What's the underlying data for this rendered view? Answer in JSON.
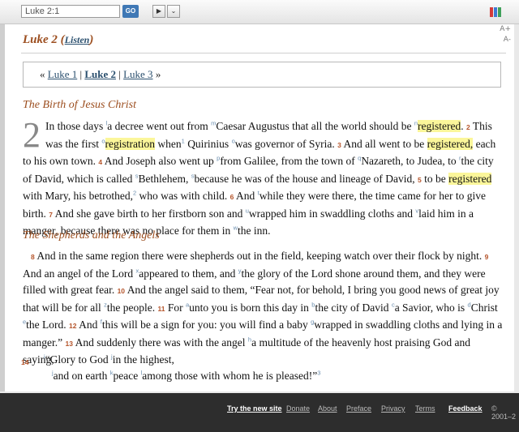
{
  "toolbar": {
    "search_value": "Luke 2:1",
    "go_label": "GO",
    "play_icon": "play-icon",
    "menu_icon": "chevron-down-icon",
    "font_increase": "A+",
    "font_decrease": "A-"
  },
  "passage": {
    "title": "Luke 2",
    "listen_label": "Listen",
    "nav": {
      "prev_open": "«",
      "prev": "Luke 1",
      "sep1": "|",
      "current": "Luke 2",
      "sep2": "|",
      "next": "Luke 3",
      "next_close": "»"
    },
    "sections": [
      {
        "heading": "The Birth of Jesus Christ"
      },
      {
        "heading": "The Shepherds and the Angels"
      }
    ],
    "chapter_number": "2"
  },
  "text": {
    "p1": [
      "In those days ",
      "a decree went out from ",
      "Caesar Augustus that all the world should be ",
      "registered",
      ".",
      "This was the first ",
      "registration",
      " when",
      " Quirinius ",
      "was governor of Syria.",
      "And all went to be ",
      "registered,",
      " each to his own town.",
      "And Joseph also went up ",
      "from Galilee, from the town of ",
      "Nazareth, to Judea, to ",
      "the city of David, which is called ",
      "Bethlehem, ",
      "because he was of the house and lineage of David,",
      "to be ",
      "registered",
      " with Mary, his betrothed,",
      " who was with child.",
      "And ",
      "while they were there, the time came for her to give birth.",
      "And she gave birth to her firstborn son and ",
      "wrapped him in swaddling cloths and ",
      "laid him in a manger, because there was no place for them in ",
      "the inn."
    ],
    "p2": [
      "And in the same region there were shepherds out in the field, keeping watch over their flock by night.",
      "And an angel of the Lord ",
      "appeared to them, and ",
      "the glory of the Lord shone around them, and they were filled with great fear.",
      "And the angel said to them, “Fear not, for behold, I bring you good news of great joy that will be for all ",
      "the people.",
      "For ",
      "unto you is born this day in ",
      "the city of David ",
      "a Savior, who is ",
      "Christ ",
      "the Lord.",
      "And ",
      "this will be a sign for you: you will find a baby ",
      "wrapped in swaddling cloths and lying in a manger.”",
      "And suddenly there was with the angel ",
      "a multitude of the heavenly host praising God and saying,"
    ],
    "poem": [
      "“Glory to God ",
      "in the highest,",
      "and on earth ",
      "peace ",
      "among those with whom he is pleased!”"
    ],
    "verse_numbers": [
      "2",
      "3",
      "4",
      "5",
      "6",
      "7",
      "8",
      "9",
      "10",
      "11",
      "12",
      "13",
      "14"
    ],
    "footnotes": [
      "l",
      "m",
      "n",
      "1",
      "o",
      "p",
      "q",
      "r",
      "s",
      "t",
      "u",
      "v",
      "w",
      "x",
      "y",
      "z",
      "a",
      "b",
      "c",
      "d",
      "e",
      "f",
      "g",
      "h",
      "i",
      "j",
      "k",
      "l",
      "2",
      "3"
    ]
  },
  "footer": {
    "links": [
      "Try the new site",
      "Donate",
      "About",
      "Preface",
      "Privacy",
      "Terms",
      "Feedback"
    ],
    "copyright": "© 2001–2"
  },
  "colors": {
    "accent": "#9c4e1f",
    "link": "#2a4f6e",
    "highlight": "#fbf69a",
    "go": "#3f78b5"
  }
}
